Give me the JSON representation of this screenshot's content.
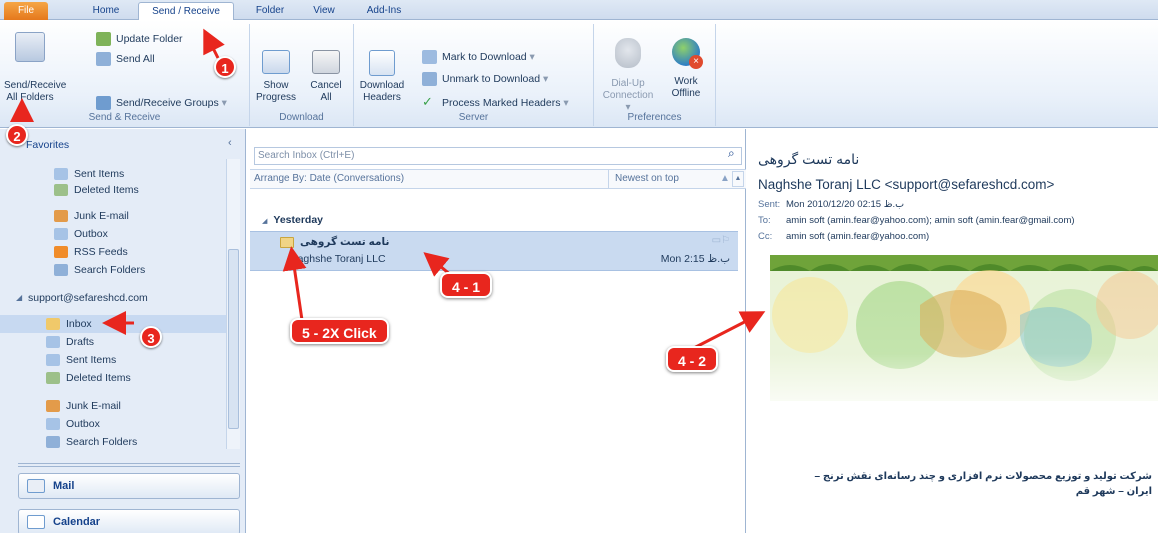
{
  "tabs": [
    "File",
    "Home",
    "Send / Receive",
    "Folder",
    "View",
    "Add-Ins"
  ],
  "ribbon": {
    "send_receive_all_line1": "Send/Receive",
    "send_receive_all_line2": "All Folders",
    "update_folder": "Update Folder",
    "send_all": "Send All",
    "send_receive_groups": "Send/Receive Groups",
    "group_send_receive": "Send & Receive",
    "show_progress_line1": "Show",
    "show_progress_line2": "Progress",
    "cancel_all_line1": "Cancel",
    "cancel_all_line2": "All",
    "group_download": "Download",
    "download_headers_line1": "Download",
    "download_headers_line2": "Headers",
    "mark_to_download": "Mark to Download",
    "unmark_to_download": "Unmark to Download",
    "process_marked_headers": "Process Marked Headers",
    "group_server": "Server",
    "dialup_line1": "Dial-Up",
    "dialup_line2": "Connection",
    "work_offline_line1": "Work",
    "work_offline_line2": "Offline",
    "group_preferences": "Preferences"
  },
  "nav": {
    "favorites": "Favorites",
    "fav_items": [
      "Sent Items",
      "Deleted Items",
      "Junk E-mail",
      "Outbox",
      "RSS Feeds",
      "Search Folders"
    ],
    "account": "support@sefareshcd.com",
    "account_items": [
      "Inbox",
      "Drafts",
      "Sent Items",
      "Deleted Items",
      "Junk E-mail",
      "Outbox",
      "Search Folders"
    ],
    "mail_button": "Mail",
    "calendar_button": "Calendar"
  },
  "list": {
    "search_placeholder": "Search Inbox (Ctrl+E)",
    "arrange_by": "Arrange By: Date (Conversations)",
    "newest_on_top": "Newest on top",
    "group_yesterday": "Yesterday",
    "message": {
      "subject": "نامه تست گروهی",
      "sender": "Naghshe Toranj LLC",
      "time": "Mon 2:15 ب.ظ"
    }
  },
  "reader": {
    "subject": "نامه تست گروهی",
    "from": "Naghshe Toranj LLC <support@sefareshcd.com>",
    "sent_label": "Sent:",
    "sent_value": "Mon 2010/12/20 02:15 ب.ظ",
    "to_label": "To:",
    "to_value": "amin soft (amin.fear@yahoo.com); amin soft (amin.fear@gmail.com)",
    "cc_label": "Cc:",
    "cc_value": "amin soft (amin.fear@yahoo.com)",
    "body_line1": "شرکت تولید و توزیع محصولات نرم افزاری و چند رسانه‌ای نقش ترنج –",
    "body_line2": "ایران – شهر قم"
  },
  "annotations": {
    "b1": "1",
    "b2": "2",
    "b3": "3",
    "c41": "4 - 1",
    "c42": "4 - 2",
    "c52": "5 - 2X Click"
  },
  "colors": {
    "accent": "#15428b",
    "annotation": "#e8261e",
    "selection": "#c9daf0",
    "file_tab": "#e5781c"
  }
}
